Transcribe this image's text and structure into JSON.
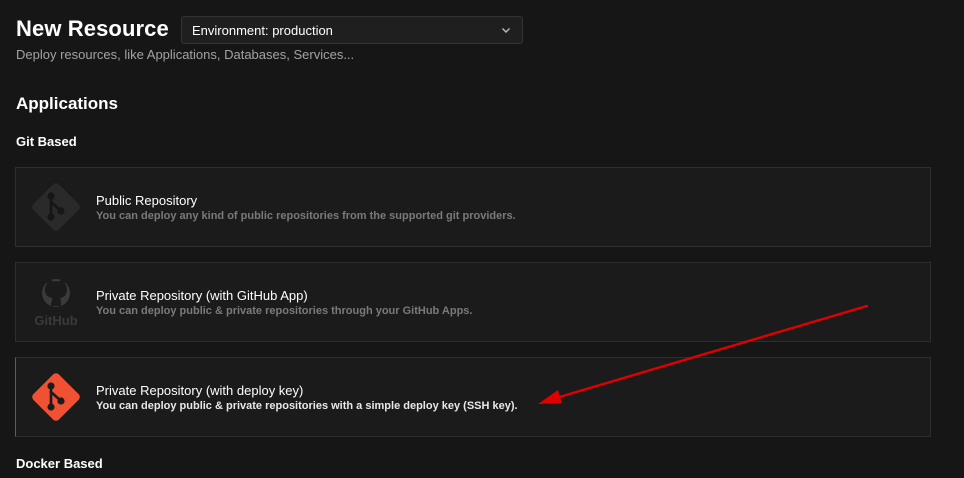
{
  "header": {
    "title": "New Resource",
    "environment_select": "Environment: production",
    "subtitle": "Deploy resources, like Applications, Databases, Services..."
  },
  "section": {
    "title": "Applications",
    "git_group_title": "Git Based",
    "docker_group_title": "Docker Based"
  },
  "cards": [
    {
      "title": "Public Repository",
      "description": "You can deploy any kind of public repositories from the supported git providers.",
      "icon": "git-icon"
    },
    {
      "title": "Private Repository (with GitHub App)",
      "description": "You can deploy public & private repositories through your GitHub Apps.",
      "icon": "github-icon"
    },
    {
      "title": "Private Repository (with deploy key)",
      "description": "You can deploy public & private repositories with a simple deploy key (SSH key).",
      "icon": "git-icon"
    }
  ],
  "github_logo_text": "GitHub",
  "colors": {
    "background": "#161616",
    "card": "#1b1b1b",
    "git_orange": "#f05133",
    "annotation_arrow": "#e00000"
  }
}
